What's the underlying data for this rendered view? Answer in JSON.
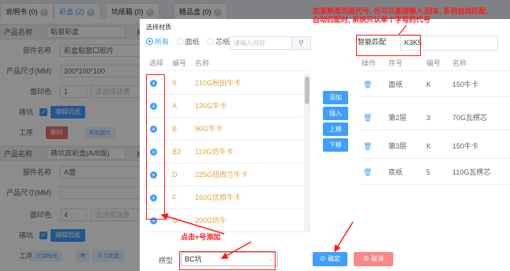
{
  "tabs": [
    {
      "label": "说明书 (0)",
      "active": false
    },
    {
      "label": "彩盒 (2)",
      "active": true
    },
    {
      "label": "坑纸箱 (0)",
      "active": false
    },
    {
      "label": "精品盒 (0)",
      "active": false
    }
  ],
  "background_form": {
    "section1": {
      "label": "产品名称",
      "value": "粘窗彩盒",
      "extra": "成"
    },
    "part_name": {
      "label": "部件名称",
      "value": "彩盒粘窗口胶片"
    },
    "size1": {
      "label": "产品尺寸(MM)",
      "value": "200*100*100"
    },
    "print1": {
      "label": "面印色",
      "value": "1",
      "select_placeholder": "请选择油墨"
    },
    "flute1": {
      "label": "裱坑",
      "button": "编辑坑纸"
    },
    "process1": {
      "label": "工序",
      "delete_btn": "删除",
      "tag": "机贴胶片"
    },
    "section2": {
      "label": "产品名称",
      "value": "裱坑双彩盒(A/B版)",
      "extra": "成"
    },
    "part_name2": {
      "label": "部件名称",
      "value": "A面"
    },
    "size2": {
      "label": "产品尺寸(MM)",
      "value": ""
    },
    "print2": {
      "label": "面印色",
      "value": "4",
      "select_placeholder": "请选择油墨"
    },
    "flute2": {
      "label": "裱坑",
      "button": "编辑坑纸"
    },
    "process2": {
      "label": "工序",
      "tags": [
        "过油哑光",
        "啤",
        "手工粘盒"
      ]
    }
  },
  "dialog": {
    "title": "选择材质",
    "radios": [
      "所有",
      "面纸",
      "芯纸"
    ],
    "search_placeholder": "请输入内容",
    "search_icon": "search-icon",
    "left_headers": {
      "select": "选择",
      "code": "编号",
      "name": "名称"
    },
    "materials": [
      {
        "code": "9",
        "name": "210G秋田牛卡"
      },
      {
        "code": "A",
        "name": "130G牛卡"
      },
      {
        "code": "B",
        "name": "90G牛卡"
      },
      {
        "code": "B2",
        "name": "110G仿牛卡"
      },
      {
        "code": "D",
        "name": "225G纽西兰牛卡"
      },
      {
        "code": "F",
        "name": "160G优质牛卡"
      },
      {
        "code": "G",
        "name": "200G仿牛"
      }
    ],
    "mid_buttons": [
      "添加",
      "插入",
      "上移",
      "下移"
    ],
    "smart_label": "智能匹配",
    "smart_value": "K3K5",
    "right_headers": {
      "op": "操作",
      "seq": "序号",
      "code": "编号",
      "name": "名称"
    },
    "layers": [
      {
        "seq": "面纸",
        "code": "K",
        "name": "150牛卡"
      },
      {
        "seq": "第2层",
        "code": "3",
        "name": "70G瓦楞芯"
      },
      {
        "seq": "第3层",
        "code": "K",
        "name": "150牛卡"
      },
      {
        "seq": "底纸",
        "code": "5",
        "name": "110G瓦楞芯"
      }
    ],
    "model_label": "楞型",
    "model_value": "BC坑",
    "ok_label": "确定",
    "cancel_label": "取消"
  },
  "annotations": {
    "top_note_line1": "如果熟悉坑纸代号, 也可以直接输入,回车, 系统自动匹配.",
    "top_note_line2": "自动匹配时, 系统只认单个字母的代号",
    "bottom_note": "点击+号添加",
    "color": "#ff1a1a"
  },
  "colors": {
    "primary": "#409eff",
    "danger": "#f56c6c",
    "material_text": "#e6a23c"
  }
}
